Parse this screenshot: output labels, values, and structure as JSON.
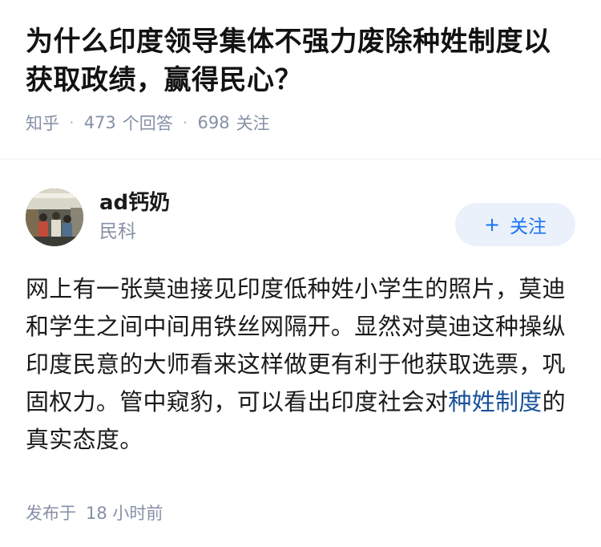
{
  "question": {
    "title": "为什么印度领导集体不强力废除种姓制度以获取政绩，赢得民心？",
    "source": "知乎",
    "answer_count": "473",
    "answer_label": "个回答",
    "follower_count": "698",
    "follower_label": "关注"
  },
  "answer": {
    "author": {
      "name": "ad钙奶",
      "description": "民科"
    },
    "follow_button": {
      "icon": "+",
      "label": "关注"
    },
    "content_before_link": "网上有一张莫迪接见印度低种姓小学生的照片，莫迪和学生之间中间用铁丝网隔开。显然对莫迪这种操纵印度民意的大师看来这样做更有利于他获取选票，巩固权力。管中窥豹，可以看出印度社会对",
    "link_text": "种姓制度",
    "content_after_link": "的真实态度。",
    "published_label": "发布于",
    "published_time": "18 小时前"
  },
  "colors": {
    "accent": "#1772f6",
    "link": "#175199",
    "meta": "#8590a6",
    "follow_bg": "#ebf1fa"
  }
}
